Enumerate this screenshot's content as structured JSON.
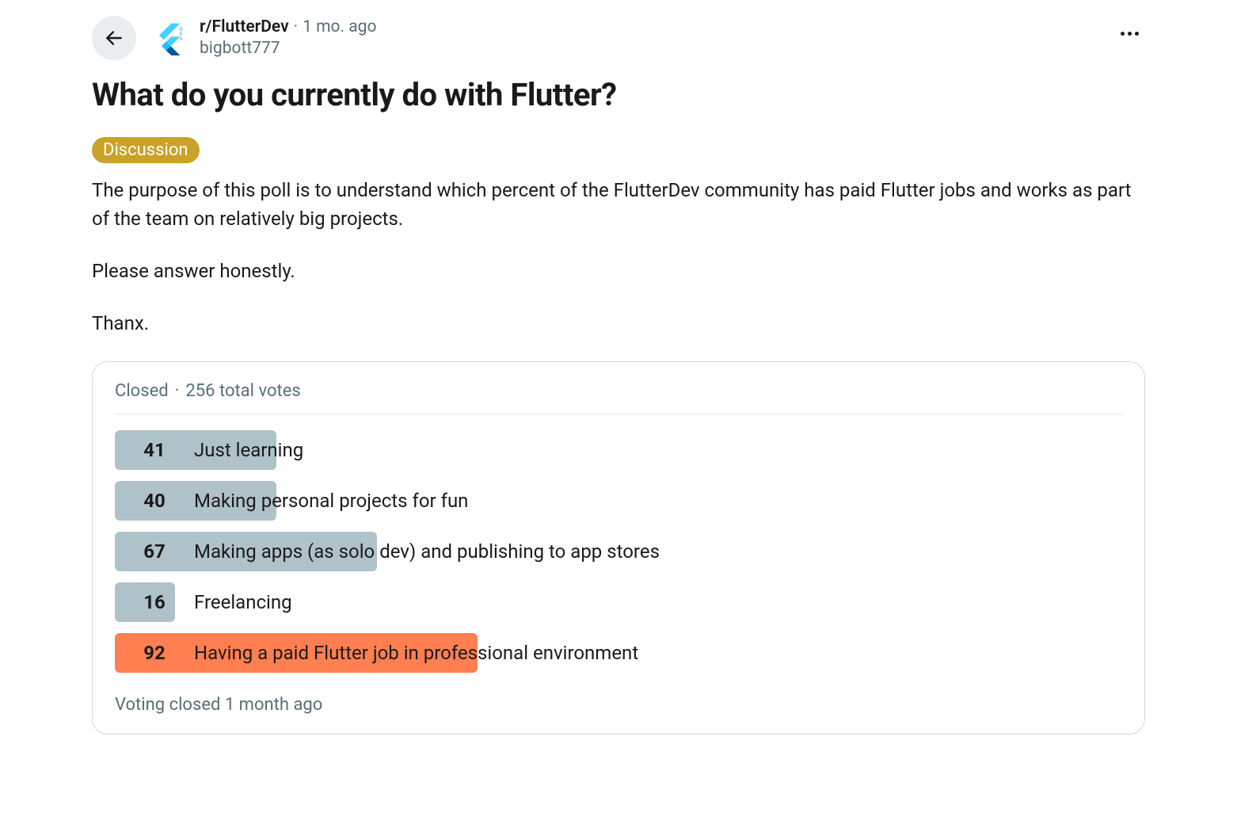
{
  "header": {
    "subreddit": "r/FlutterDev",
    "separator": "·",
    "time": "1 mo. ago",
    "author": "bigbott777"
  },
  "post": {
    "title": "What do you currently do with Flutter?",
    "flair": "Discussion",
    "body": {
      "p1": "The purpose of this poll is to understand which percent of the FlutterDev community has paid Flutter jobs and works as part of the team on relatively big projects.",
      "p2": "Please answer honestly.",
      "p3": "Thanx."
    }
  },
  "poll": {
    "status": "Closed",
    "separator": "·",
    "totals": "256 total votes",
    "options": [
      {
        "count": "41",
        "label": "Just learning",
        "width_pct": 16,
        "winner": false
      },
      {
        "count": "40",
        "label": "Making personal projects for fun",
        "width_pct": 16,
        "winner": false
      },
      {
        "count": "67",
        "label": "Making apps (as solo dev) and publishing to app stores",
        "width_pct": 26,
        "winner": false
      },
      {
        "count": "16",
        "label": "Freelancing",
        "width_pct": 6,
        "winner": false
      },
      {
        "count": "92",
        "label": "Having a paid Flutter job in professional environment",
        "width_pct": 36,
        "winner": true
      }
    ],
    "footer": "Voting closed 1 month ago"
  },
  "chart_data": {
    "type": "bar",
    "title": "What do you currently do with Flutter?",
    "categories": [
      "Just learning",
      "Making personal projects for fun",
      "Making apps (as solo dev) and publishing to app stores",
      "Freelancing",
      "Having a paid Flutter job in professional environment"
    ],
    "values": [
      41,
      40,
      67,
      16,
      92
    ],
    "total_votes": 256
  }
}
